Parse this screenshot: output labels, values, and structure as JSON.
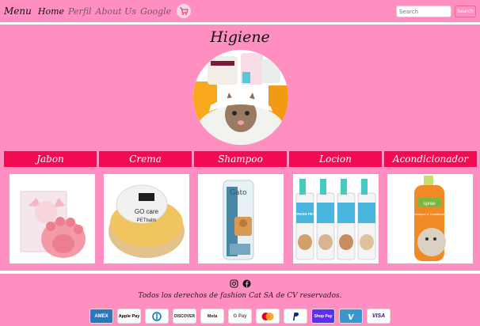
{
  "navbar": {
    "brand": "Menu",
    "links": [
      "Home",
      "Perfil",
      "About Us",
      "Google"
    ],
    "search_placeholder": "Search",
    "search_button": "Search"
  },
  "page": {
    "title": "Higiene"
  },
  "categories": [
    "Jabon",
    "Crema",
    "Shampoo",
    "Locion",
    "Acondicionador"
  ],
  "products": {
    "crema_brand": "GO care",
    "crema_name": "PETbalm",
    "shampoo_brand": "Gato",
    "locion_brand": "FRESH PET",
    "acond_brand": "spree",
    "acond_name": "Shampoo & Conditioner"
  },
  "footer": {
    "copyright": "Todos los derechos de fashion Cat SA de CV reservados.",
    "payments": [
      "AMEX",
      "Apple Pay",
      "Diners",
      "DISCOVER",
      "Meta",
      "G Pay",
      "Mastercard",
      "PayPal",
      "Shop Pay",
      "Venmo",
      "VISA"
    ]
  }
}
